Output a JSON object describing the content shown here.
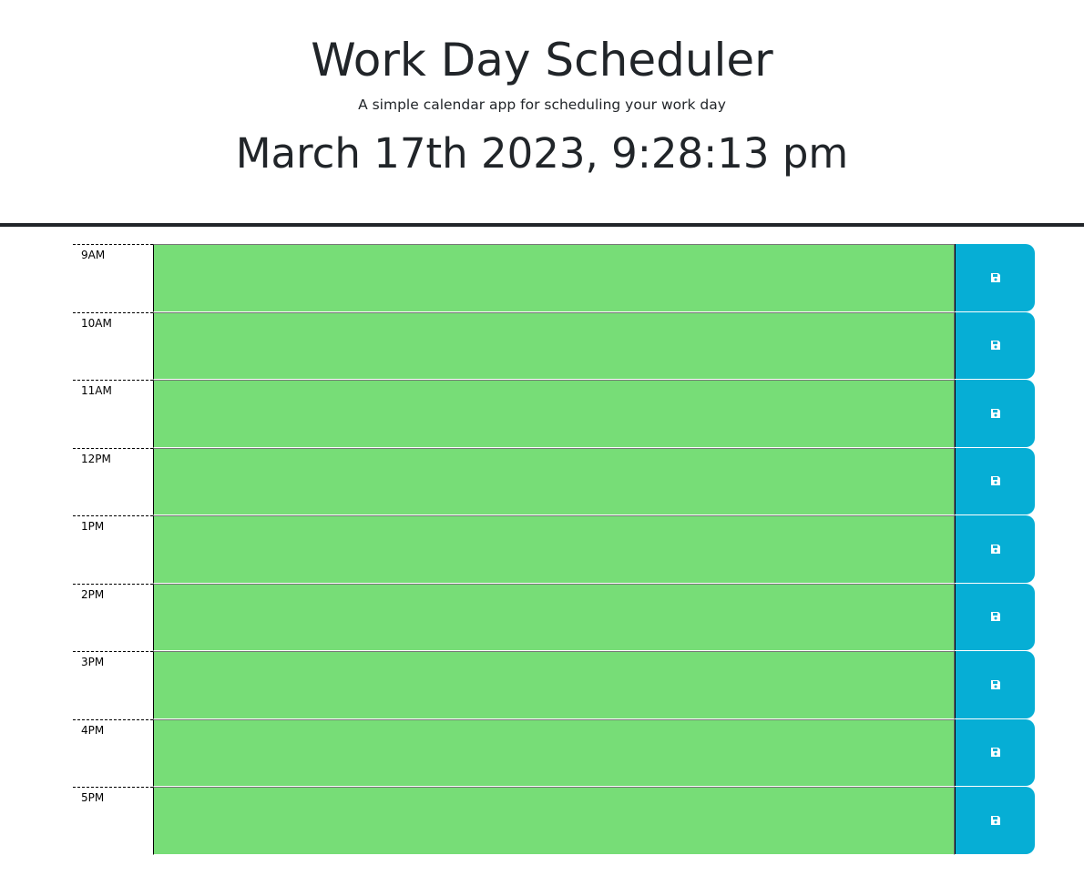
{
  "header": {
    "title": "Work Day Scheduler",
    "subtitle": "A simple calendar app for scheduling your work day",
    "current_day": "March 17th 2023, 9:28:13 pm"
  },
  "colors": {
    "future": "#77dd77",
    "save_button": "#06aed5"
  },
  "time_blocks": [
    {
      "hour": "9AM",
      "description": "",
      "state": "future",
      "save_icon": "save-icon"
    },
    {
      "hour": "10AM",
      "description": "",
      "state": "future",
      "save_icon": "save-icon"
    },
    {
      "hour": "11AM",
      "description": "",
      "state": "future",
      "save_icon": "save-icon"
    },
    {
      "hour": "12PM",
      "description": "",
      "state": "future",
      "save_icon": "save-icon"
    },
    {
      "hour": "1PM",
      "description": "",
      "state": "future",
      "save_icon": "save-icon"
    },
    {
      "hour": "2PM",
      "description": "",
      "state": "future",
      "save_icon": "save-icon"
    },
    {
      "hour": "3PM",
      "description": "",
      "state": "future",
      "save_icon": "save-icon"
    },
    {
      "hour": "4PM",
      "description": "",
      "state": "future",
      "save_icon": "save-icon"
    },
    {
      "hour": "5PM",
      "description": "",
      "state": "future",
      "save_icon": "save-icon"
    }
  ]
}
